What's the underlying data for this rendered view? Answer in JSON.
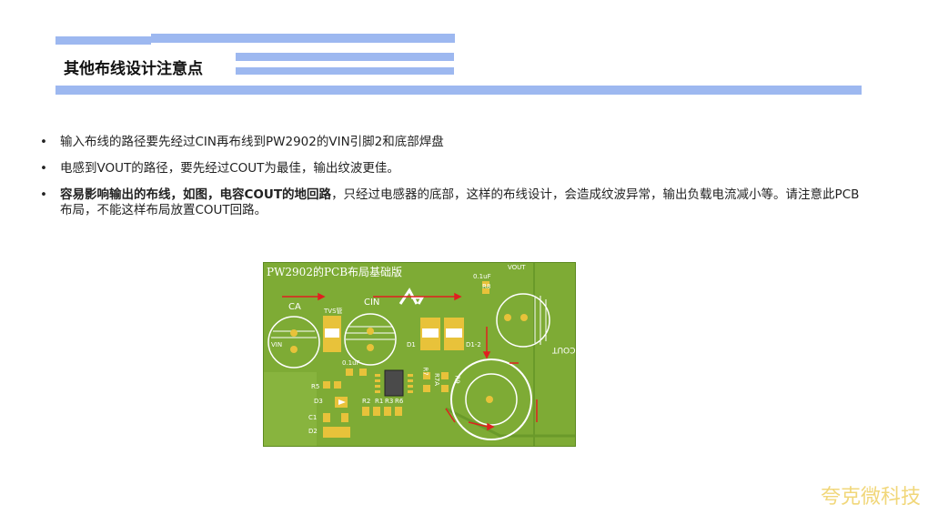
{
  "header": {
    "title": "其他布线设计注意点"
  },
  "bullets": [
    {
      "bold": "",
      "text": "输入布线的路径要先经过CIN再布线到PW2902的VIN引脚2和底部焊盘"
    },
    {
      "bold": "",
      "text": "电感到VOUT的路径，要先经过COUT为最佳，输出纹波更佳。"
    },
    {
      "bold": "容易影响输出的布线，如图，电容COUT的地回路",
      "text": "，只经过电感器的底部，这样的布线设计，会造成纹波异常，输出负载电流减小等。请注意此PCB布局，不能这样布局放置COUT回路。"
    }
  ],
  "pcb": {
    "title": "PW2902的PCB布局基础版",
    "labels": {
      "ca": "CA",
      "vin": "VIN",
      "tvs": "TVS管",
      "cin": "CIN",
      "d1": "D1",
      "d1_2": "D1-2",
      "vout": "VOUT",
      "c01uf_top": "0.1uF",
      "r8": "R8",
      "cout": "COUT",
      "c01uf_mid": "0.1uF",
      "r5": "R5",
      "d3": "D3",
      "c1": "C1",
      "d2": "D2",
      "r2": "R2",
      "r1": "R1",
      "r3": "R3",
      "r6": "R6",
      "r7": "R7",
      "r7a": "R7A",
      "r9": "R9"
    }
  },
  "watermark": "夸克微科技",
  "colors": {
    "bar": "#9db8f0",
    "pcb": "#7eab35",
    "pad": "#e8c23a",
    "arrow": "#e02020",
    "watermark": "#f1d77a"
  }
}
